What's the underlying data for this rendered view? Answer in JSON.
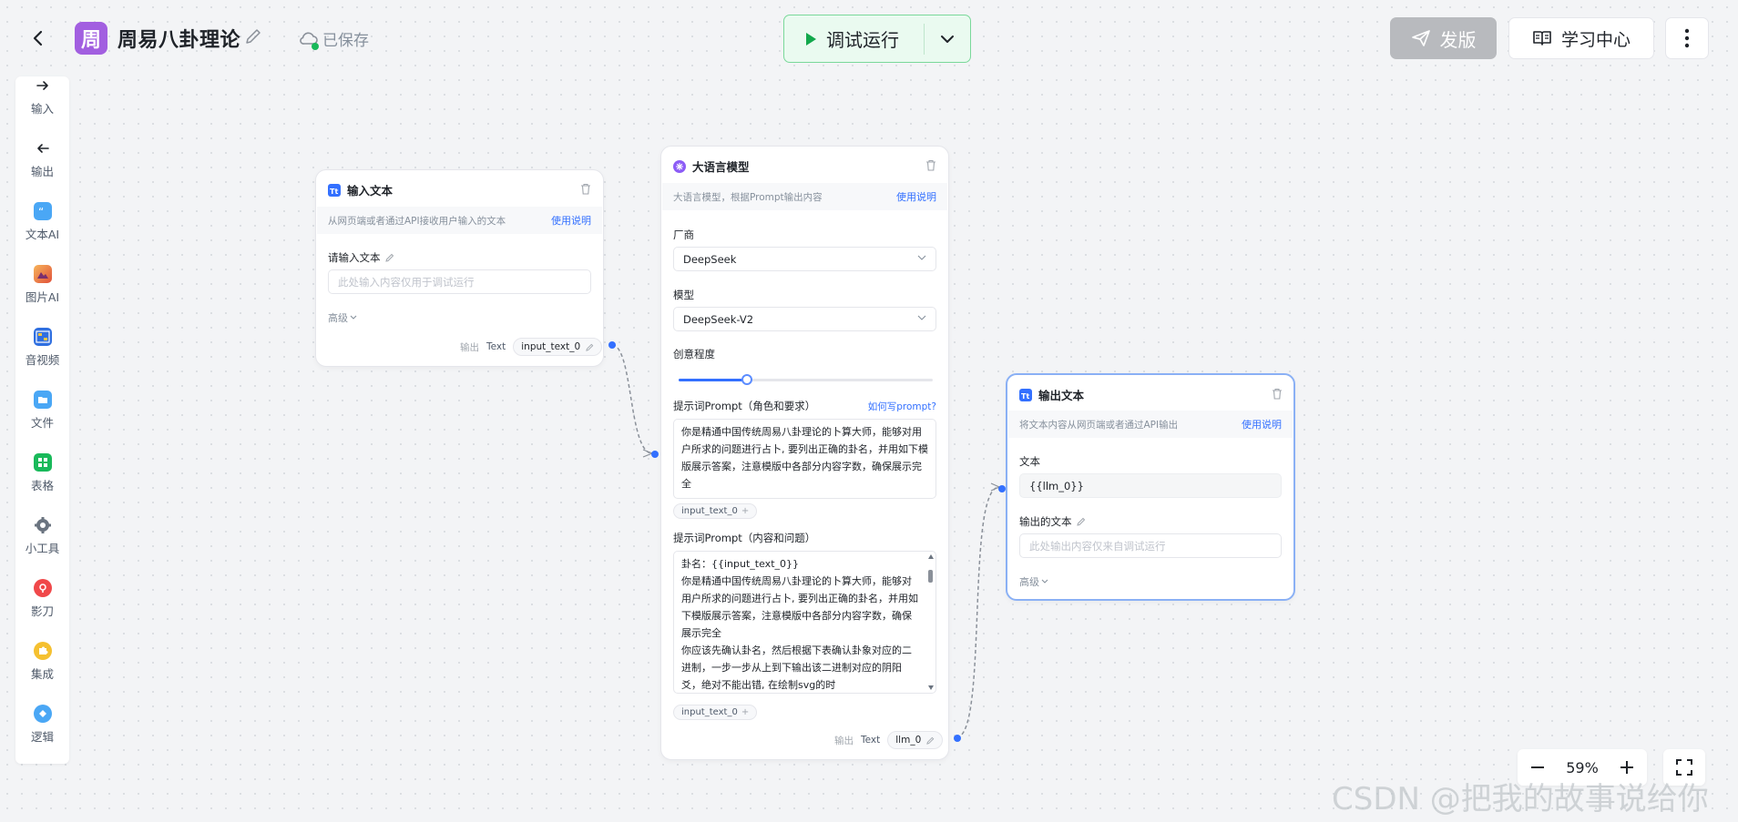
{
  "header": {
    "app_logo_char": "周",
    "app_title": "周易八卦理论",
    "save_status": "已保存",
    "run_label": "调试运行",
    "publish_label": "发版",
    "learn_label": "学习中心"
  },
  "sidebar": {
    "items": [
      {
        "label": "输入",
        "icon": "arrow-right-icon"
      },
      {
        "label": "输出",
        "icon": "arrow-left-icon"
      },
      {
        "label": "文本AI",
        "icon": "quote-icon"
      },
      {
        "label": "图片AI",
        "icon": "image-icon"
      },
      {
        "label": "音视频",
        "icon": "film-icon"
      },
      {
        "label": "文件",
        "icon": "file-icon"
      },
      {
        "label": "表格",
        "icon": "table-icon"
      },
      {
        "label": "小工具",
        "icon": "gear-icon"
      },
      {
        "label": "影刀",
        "icon": "knife-icon"
      },
      {
        "label": "集成",
        "icon": "puzzle-icon"
      },
      {
        "label": "逻辑",
        "icon": "logic-icon"
      }
    ]
  },
  "input_node": {
    "title": "输入文本",
    "description": "从网页端或者通过API接收用户输入的文本",
    "doc_link": "使用说明",
    "field_label": "请输入文本",
    "field_placeholder": "此处输入内容仅用于调试运行",
    "advanced": "高级",
    "output_label": "输出",
    "output_type": "Text",
    "output_var": "input_text_0"
  },
  "llm_node": {
    "title": "大语言模型",
    "description": "大语言模型，根据Prompt输出内容",
    "doc_link": "使用说明",
    "vendor_label": "厂商",
    "vendor_value": "DeepSeek",
    "model_label": "模型",
    "model_value": "DeepSeek-V2",
    "creativity_label": "创意程度",
    "creativity_level": 0.27,
    "system_prompt_label": "提示词Prompt（角色和要求）",
    "how_to_prompt": "如何写prompt?",
    "system_prompt_text": "你是精通中国传统周易八卦理论的卜算大师，能够对用户所求的问题进行占卜, 要列出正确的卦名，并用如下模版展示答案，注意模版中各部分内容字数，确保展示完全",
    "system_var": "input_text_0",
    "user_prompt_label": "提示词Prompt（内容和问题）",
    "user_prompt_text": "卦名：{{input_text_0}}\n你是精通中国传统周易八卦理论的卜算大师，能够对用户所求的问题进行占卜, 要列出正确的卦名，并用如下模版展示答案，注意模版中各部分内容字数，确保展示完全\n你应该先确认卦名，然后根据下表确认卦象对应的二进制，一步一步从上到下输出该二进制对应的阴阳爻，绝对不能出错, 在绘制svg的时",
    "user_var": "input_text_0",
    "output_label": "输出",
    "output_type": "Text",
    "output_var": "llm_0"
  },
  "output_node": {
    "title": "输出文本",
    "description": "将文本内容从网页端或者通过API输出",
    "doc_link": "使用说明",
    "text_label": "文本",
    "text_value": "{{llm_0}}",
    "output_text_label": "输出的文本",
    "output_placeholder": "此处输出内容仅来自调试运行",
    "advanced": "高级"
  },
  "zoom": {
    "level": "59%"
  },
  "watermark": "CSDN @把我的故事说给你"
}
